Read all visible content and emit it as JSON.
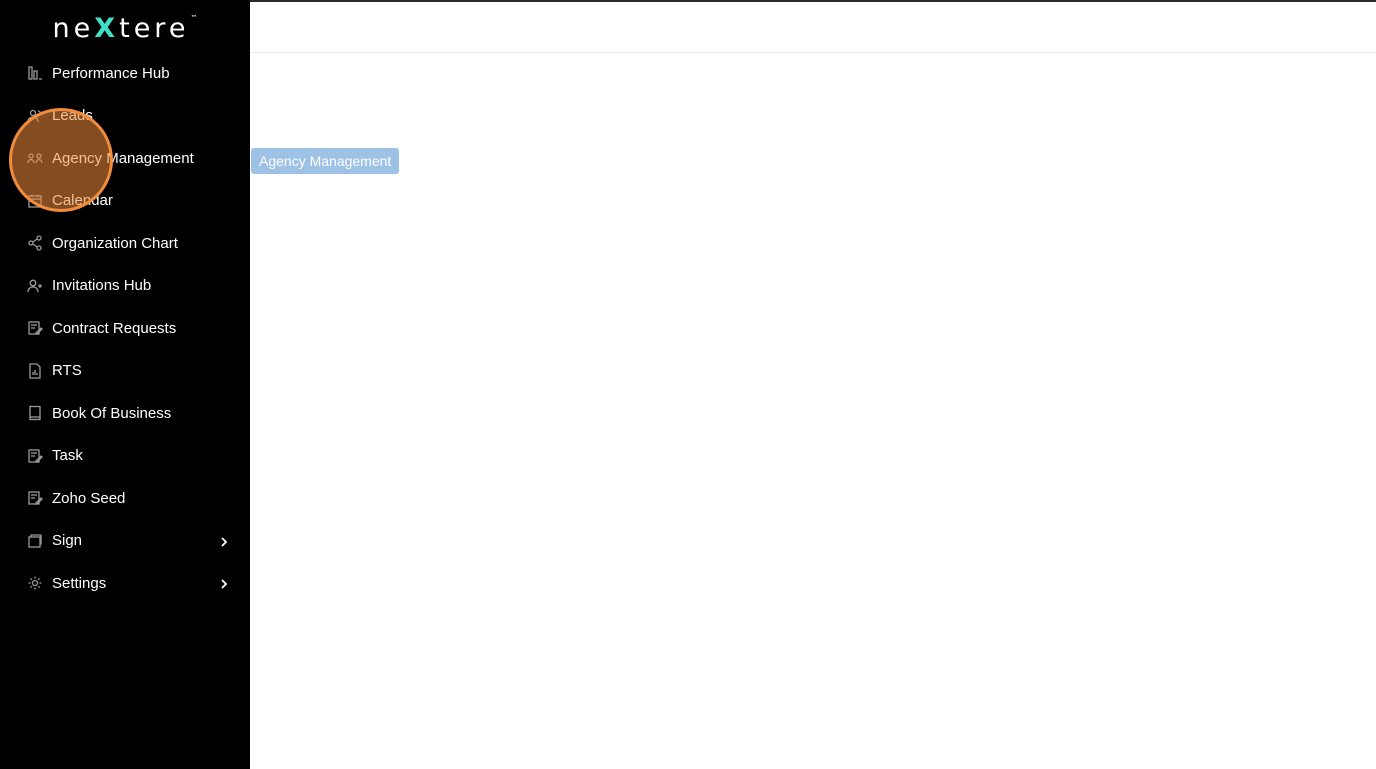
{
  "brand": {
    "logo_pre": "ne",
    "logo_x": "X",
    "logo_post": "tere",
    "logo_tm": "™"
  },
  "sidebar": {
    "items": [
      {
        "label": "Performance Hub",
        "icon": "bar-chart-icon"
      },
      {
        "label": "Leads",
        "icon": "users-icon"
      },
      {
        "label": "Agency Management",
        "icon": "group-icon"
      },
      {
        "label": "Calendar",
        "icon": "calendar-icon"
      },
      {
        "label": "Organization Chart",
        "icon": "share-icon"
      },
      {
        "label": "Invitations Hub",
        "icon": "user-plus-icon"
      },
      {
        "label": "Contract Requests",
        "icon": "edit-document-icon"
      },
      {
        "label": "RTS",
        "icon": "report-icon"
      },
      {
        "label": "Book Of Business",
        "icon": "book-icon"
      },
      {
        "label": "Task",
        "icon": "edit-document-icon"
      },
      {
        "label": "Zoho Seed",
        "icon": "edit-document-icon"
      },
      {
        "label": "Sign",
        "icon": "window-icon",
        "has_submenu": true
      },
      {
        "label": "Settings",
        "icon": "gear-icon",
        "has_submenu": true
      }
    ]
  },
  "tooltip": {
    "text": "Agency Management"
  },
  "colors": {
    "sidebar_bg": "#000000",
    "accent": "#3ee0c8",
    "tooltip_bg": "#9ec2e6",
    "click_marker": "#f08c3c"
  }
}
